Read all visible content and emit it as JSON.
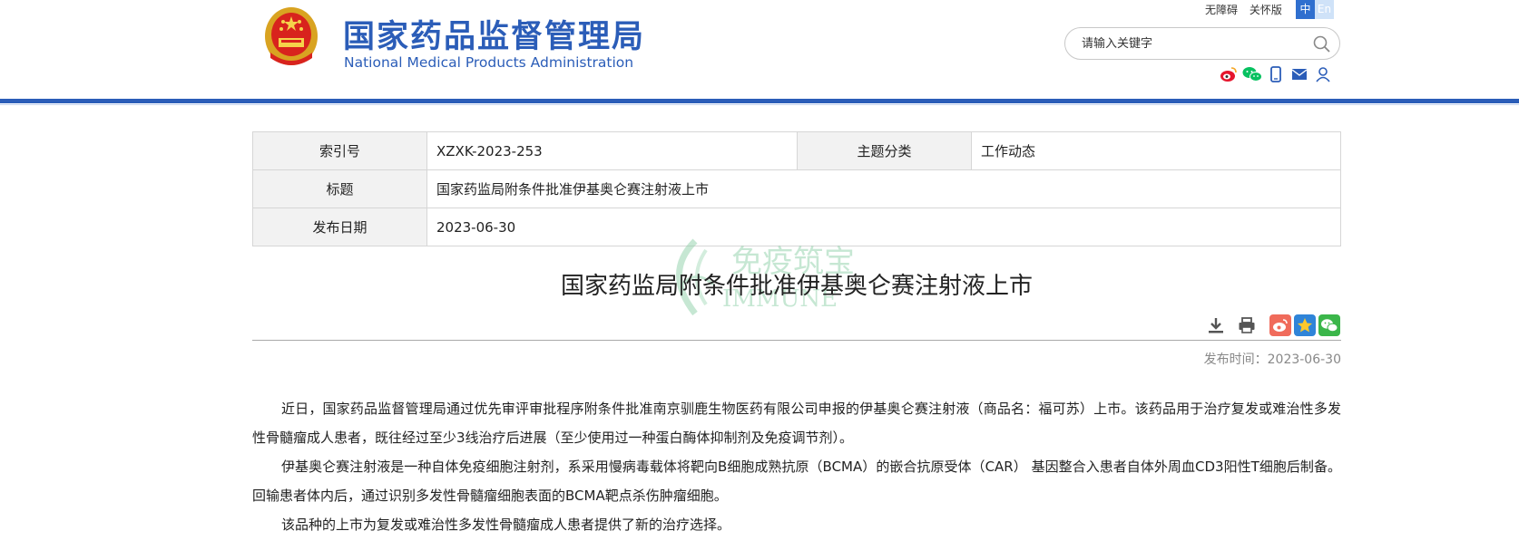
{
  "header": {
    "title_cn": "国家药品监督管理局",
    "title_en": "National Medical Products Administration",
    "links": [
      "无障碍",
      "关怀版"
    ],
    "lang_cn": "中",
    "lang_en": "En",
    "search_placeholder": "请输入关键字",
    "social_icons": [
      "weibo-icon",
      "wechat-icon",
      "mobile-icon",
      "mail-icon",
      "user-icon"
    ]
  },
  "meta": {
    "index_label": "索引号",
    "index_value": "XZXK-2023-253",
    "category_label": "主题分类",
    "category_value": "工作动态",
    "title_label": "标题",
    "title_value": "国家药监局附条件批准伊基奥仑赛注射液上市",
    "date_label": "发布日期",
    "date_value": "2023-06-30"
  },
  "article": {
    "title": "国家药监局附条件批准伊基奥仑赛注射液上市",
    "publish_time": "发布时间：2023-06-30",
    "paragraphs": [
      "近日，国家药品监督管理局通过优先审评审批程序附条件批准南京驯鹿生物医药有限公司申报的伊基奥仑赛注射液（商品名：福可苏）上市。该药品用于治疗复发或难治性多发性骨髓瘤成人患者，既往经过至少3线治疗后进展（至少使用过一种蛋白酶体抑制剂及免疫调节剂）。",
      "伊基奥仑赛注射液是一种自体免疫细胞注射剂，系采用慢病毒载体将靶向B细胞成熟抗原（BCMA）的嵌合抗原受体（CAR） 基因整合入患者自体外周血CD3阳性T细胞后制备。回输患者体内后，通过识别多发性骨髓瘤细胞表面的BCMA靶点杀伤肿瘤细胞。",
      "该品种的上市为复发或难治性多发性骨髓瘤成人患者提供了新的治疗选择。"
    ]
  },
  "watermark": {
    "text_cn": "免疫筑宝",
    "text_en": "IMMUNE"
  },
  "colors": {
    "brand_blue": "#2b5db8",
    "weibo_red": "#e6162d",
    "wechat_green": "#07c160"
  }
}
